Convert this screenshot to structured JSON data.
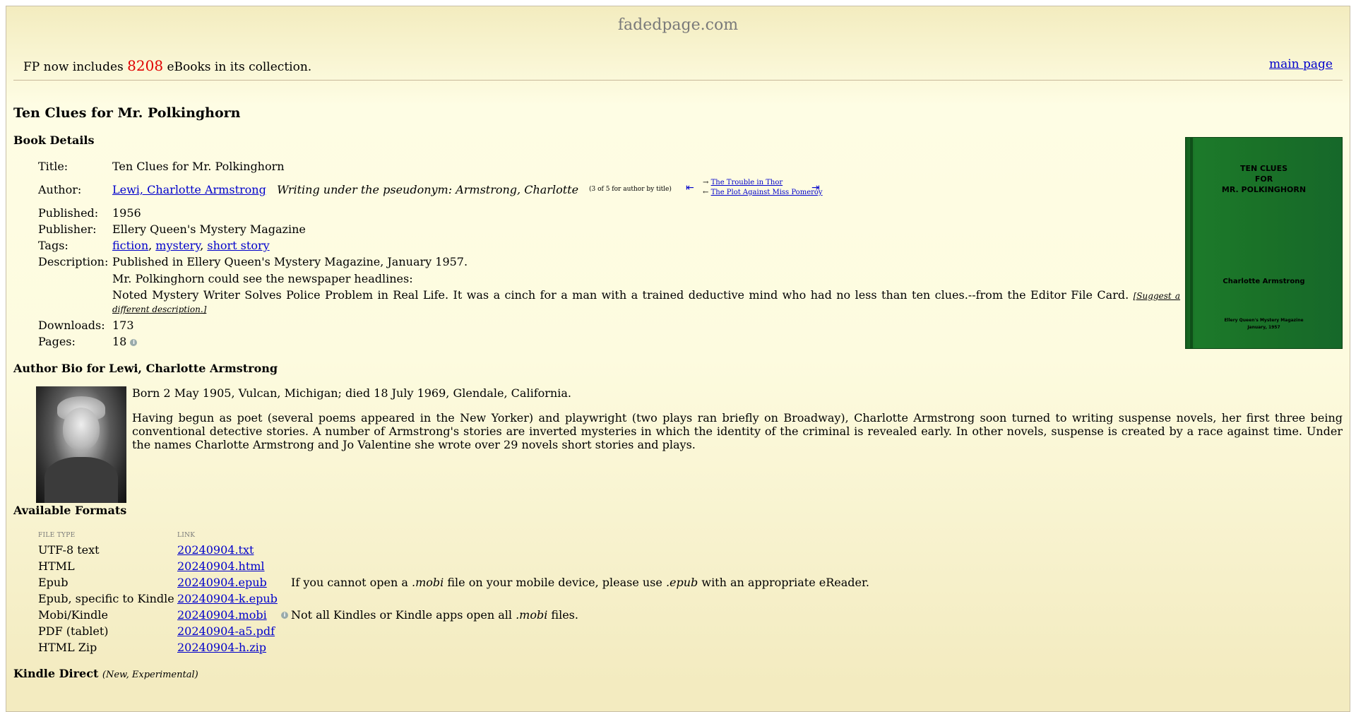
{
  "site": {
    "title": "fadedpage.com",
    "main_page_link": "main page"
  },
  "collection": {
    "prefix": "FP now includes",
    "count": "8208",
    "suffix": "eBooks in its collection."
  },
  "book": {
    "heading": "Ten Clues for Mr. Polkinghorn",
    "details_heading": "Book Details",
    "labels": {
      "title": "Title:",
      "author": "Author:",
      "published": "Published:",
      "publisher": "Publisher:",
      "tags": "Tags:",
      "description": "Description:",
      "downloads": "Downloads:",
      "pages": "Pages:"
    },
    "title": "Ten Clues for Mr. Polkinghorn",
    "author": "Lewi, Charlotte Armstrong",
    "pseudonym": "Writing under the pseudonym: Armstrong, Charlotte",
    "author_position": "(3 of 5 for author by title)",
    "next_title": "The Trouble in Thor",
    "prev_title": "The Plot Against Miss Pomeroy",
    "published": "1956",
    "publisher": "Ellery Queen's Mystery Magazine",
    "tags": [
      "fiction",
      "mystery",
      "short story"
    ],
    "description": [
      "Published in Ellery Queen's Mystery Magazine, January 1957.",
      "Mr. Polkinghorn could see the newspaper headlines:",
      "Noted Mystery Writer Solves Police Problem in Real Life. It was a cinch for a man with a trained deductive mind who had no less than ten clues.--from the Editor File Card."
    ],
    "suggest_link": "[Suggest a different description.]",
    "downloads": "173",
    "pages": "18",
    "cover": {
      "title_lines": [
        "TEN CLUES",
        "FOR",
        "MR. POLKINGHORN"
      ],
      "author": "Charlotte Armstrong",
      "footer_lines": [
        "Ellery Queen's Mystery Magazine",
        "January, 1957"
      ],
      "color": "#1a7128"
    }
  },
  "bio": {
    "heading": "Author Bio for Lewi, Charlotte Armstrong",
    "paragraphs": [
      "Born 2 May 1905, Vulcan, Michigan; died 18 July 1969, Glendale, California.",
      "Having begun as poet (several poems appeared in the New Yorker) and playwright (two plays ran briefly on Broadway), Charlotte Armstrong soon turned to writing suspense novels, her first three being conventional detective stories. A number of Armstrong's stories are inverted mysteries in which the identity of the criminal is revealed early. In other novels, suspense is created by a race against time. Under the names Charlotte Armstrong and Jo Valentine she wrote over 29 novels short stories and plays."
    ]
  },
  "formats": {
    "heading": "Available Formats",
    "col_type": "FILE TYPE",
    "col_link": "LINK",
    "rows": [
      {
        "type": "UTF-8 text",
        "link": "20240904.txt"
      },
      {
        "type": "HTML",
        "link": "20240904.html"
      },
      {
        "type": "Epub",
        "link": "20240904.epub"
      },
      {
        "type": "Epub, specific to Kindle",
        "link": "20240904-k.epub"
      },
      {
        "type": "Mobi/Kindle",
        "link": "20240904.mobi"
      },
      {
        "type": "PDF (tablet)",
        "link": "20240904-a5.pdf"
      },
      {
        "type": "HTML Zip",
        "link": "20240904-h.zip"
      }
    ],
    "epub_note_pre": "If you cannot open a ",
    "epub_note_em1": ".mobi",
    "epub_note_mid": " file on your mobile device, please use ",
    "epub_note_em2": ".epub",
    "epub_note_post": " with an appropriate eReader.",
    "mobi_note_pre": "Not all Kindles or Kindle apps open all ",
    "mobi_note_em": ".mobi",
    "mobi_note_post": " files."
  },
  "kindle": {
    "heading": "Kindle Direct",
    "sub": "(New, Experimental)"
  }
}
